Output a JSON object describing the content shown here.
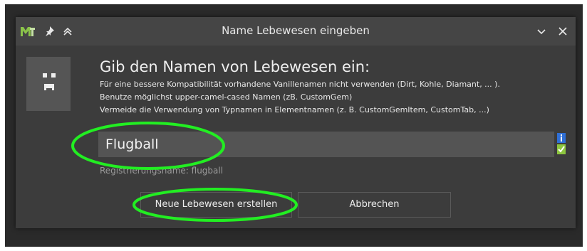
{
  "window": {
    "title": "Name Lebewesen eingeben",
    "app_icon": "mcreator-logo",
    "pin_icon": "pin-icon",
    "keep_above_icon": "double-chevron-up-icon",
    "minimize_icon": "chevron-down-icon",
    "close_icon": "close-icon"
  },
  "dialog": {
    "heading": "Gib den Namen von Lebewesen ein:",
    "info_lines": [
      "Für eine bessere Kompatibilität vorhandene Vanillenamen nicht verwenden (Dirt, Kohle, Diamant, ... ).",
      "Benutze möglichst upper-camel-cased Namen (zB. CustomGem)",
      "Vermeide die Verwendung von Typnamen in Elementnamen (z. B. CustomGemItem, CustomTab, ...)"
    ],
    "name_input_value": "Flugball",
    "registry_name": "Registrierungsname: flugball",
    "create_button": "Neue Lebewesen erstellen",
    "cancel_button": "Abbrechen"
  },
  "colors": {
    "dialog_bg": "#3c3c3c",
    "titlebar_bg": "#454545",
    "input_bg": "#545454",
    "annotation_green": "#22ee22",
    "info_blue": "#2f6fd6",
    "valid_green": "#8dc63f"
  }
}
